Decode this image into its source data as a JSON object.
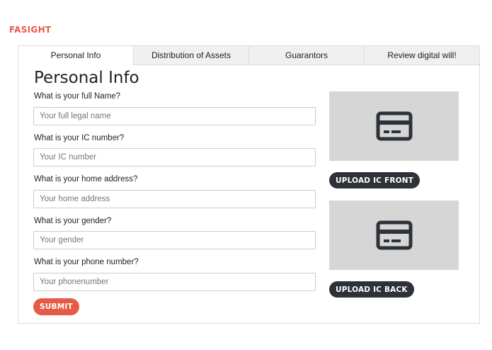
{
  "brand": {
    "name": "FASIGHT",
    "color": "#e55b45"
  },
  "tabs": [
    {
      "label": "Personal Info",
      "active": true
    },
    {
      "label": "Distribution of Assets",
      "active": false
    },
    {
      "label": "Guarantors",
      "active": false
    },
    {
      "label": "Review digital will!",
      "active": false
    }
  ],
  "form": {
    "title": "Personal Info",
    "fields": [
      {
        "label": "What is your full Name?",
        "placeholder": "Your full legal name",
        "value": ""
      },
      {
        "label": "What is your IC number?",
        "placeholder": "Your IC number",
        "value": ""
      },
      {
        "label": "What is your home address?",
        "placeholder": "Your home address",
        "value": ""
      },
      {
        "label": "What is your gender?",
        "placeholder": "Your gender",
        "value": ""
      },
      {
        "label": "What is your phone number?",
        "placeholder": "Your phonenumber",
        "value": ""
      }
    ],
    "submit_label": "SUBMIT"
  },
  "uploads": {
    "front": {
      "icon": "id-card-icon",
      "button_label": "UPLOAD IC FRONT"
    },
    "back": {
      "icon": "id-card-icon",
      "button_label": "UPLOAD IC BACK"
    }
  },
  "colors": {
    "accent": "#e55b45",
    "dark_button": "#2d3238",
    "placeholder_box": "#d6d6d6"
  }
}
